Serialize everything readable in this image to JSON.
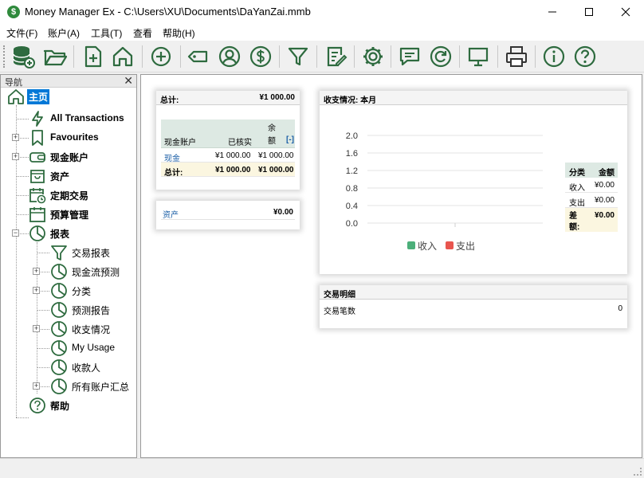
{
  "window": {
    "title": "Money Manager Ex - C:\\Users\\XU\\Documents\\DaYanZai.mmb",
    "app_icon_glyph": "$"
  },
  "menu": [
    "文件(F)",
    "账户(A)",
    "工具(T)",
    "查看",
    "帮助(H)"
  ],
  "toolbar": {
    "icons": [
      "database-add-icon",
      "folder-open-icon",
      "new-file-icon",
      "home-icon",
      "add-circle-icon",
      "tag-icon",
      "user-icon",
      "dollar-icon",
      "filter-icon",
      "edit-icon",
      "gear-icon",
      "chat-icon",
      "refresh-icon",
      "monitor-icon",
      "printer-icon",
      "info-icon",
      "help-icon"
    ],
    "color": "#2e6b3f"
  },
  "nav": {
    "header": "导航",
    "close": "✕",
    "items": [
      {
        "label": "主页",
        "icon": "home-icon",
        "selected": true
      },
      {
        "label": "All Transactions",
        "icon": "lightning-icon"
      },
      {
        "label": "Favourites",
        "icon": "bookmark-icon",
        "expander": "+"
      },
      {
        "label": "现金账户",
        "icon": "wallet-icon",
        "expander": "+"
      },
      {
        "label": "资产",
        "icon": "box-icon"
      },
      {
        "label": "定期交易",
        "icon": "calendar-clock-icon"
      },
      {
        "label": "预算管理",
        "icon": "calendar-icon"
      },
      {
        "label": "报表",
        "icon": "pie-chart-icon",
        "expander": "−"
      },
      {
        "label": "交易报表",
        "icon": "filter-icon"
      },
      {
        "label": "现金流预测",
        "icon": "pie-chart-icon",
        "expander": "+"
      },
      {
        "label": "分类",
        "icon": "pie-chart-icon",
        "expander": "+"
      },
      {
        "label": "预测报告",
        "icon": "pie-chart-icon"
      },
      {
        "label": "收支情况",
        "icon": "pie-chart-icon",
        "expander": "+"
      },
      {
        "label": "My Usage",
        "icon": "pie-chart-icon"
      },
      {
        "label": "收款人",
        "icon": "pie-chart-icon"
      },
      {
        "label": "所有账户汇总",
        "icon": "pie-chart-icon",
        "expander": "+"
      },
      {
        "label": "帮助",
        "icon": "help-icon"
      }
    ]
  },
  "home": {
    "total_card": {
      "label": "总计:",
      "value": "¥1 000.00",
      "table_headers": [
        "现金账户",
        "已核实",
        "余额"
      ],
      "toggle": "[-]",
      "rows": [
        {
          "name": "现金",
          "reconciled": "¥1 000.00",
          "balance": "¥1 000.00"
        }
      ],
      "total_row": {
        "name": "总计:",
        "reconciled": "¥1 000.00",
        "balance": "¥1 000.00"
      }
    },
    "assets_card": {
      "label": "资产",
      "value": "¥0.00"
    },
    "income_card": {
      "title": "收支情况: 本月",
      "table_headers": [
        "分类",
        "金额"
      ],
      "rows": [
        {
          "label": "收入",
          "value": "¥0.00"
        },
        {
          "label": "支出",
          "value": "¥0.00"
        },
        {
          "label": "差额:",
          "value": "¥0.00"
        }
      ]
    },
    "transactions_card": {
      "title": "交易明细",
      "label": "交易笔数",
      "count": "0"
    }
  },
  "chart_data": {
    "type": "bar",
    "categories": [
      ""
    ],
    "series": [
      {
        "name": "收入",
        "values": [
          0
        ],
        "color": "#4caf7a"
      },
      {
        "name": "支出",
        "values": [
          0
        ],
        "color": "#e8554e"
      }
    ],
    "yticks": [
      "2.0",
      "1.6",
      "1.2",
      "0.8",
      "0.4",
      "0.0"
    ],
    "ylim": [
      0,
      2
    ],
    "legend": "bottom"
  }
}
